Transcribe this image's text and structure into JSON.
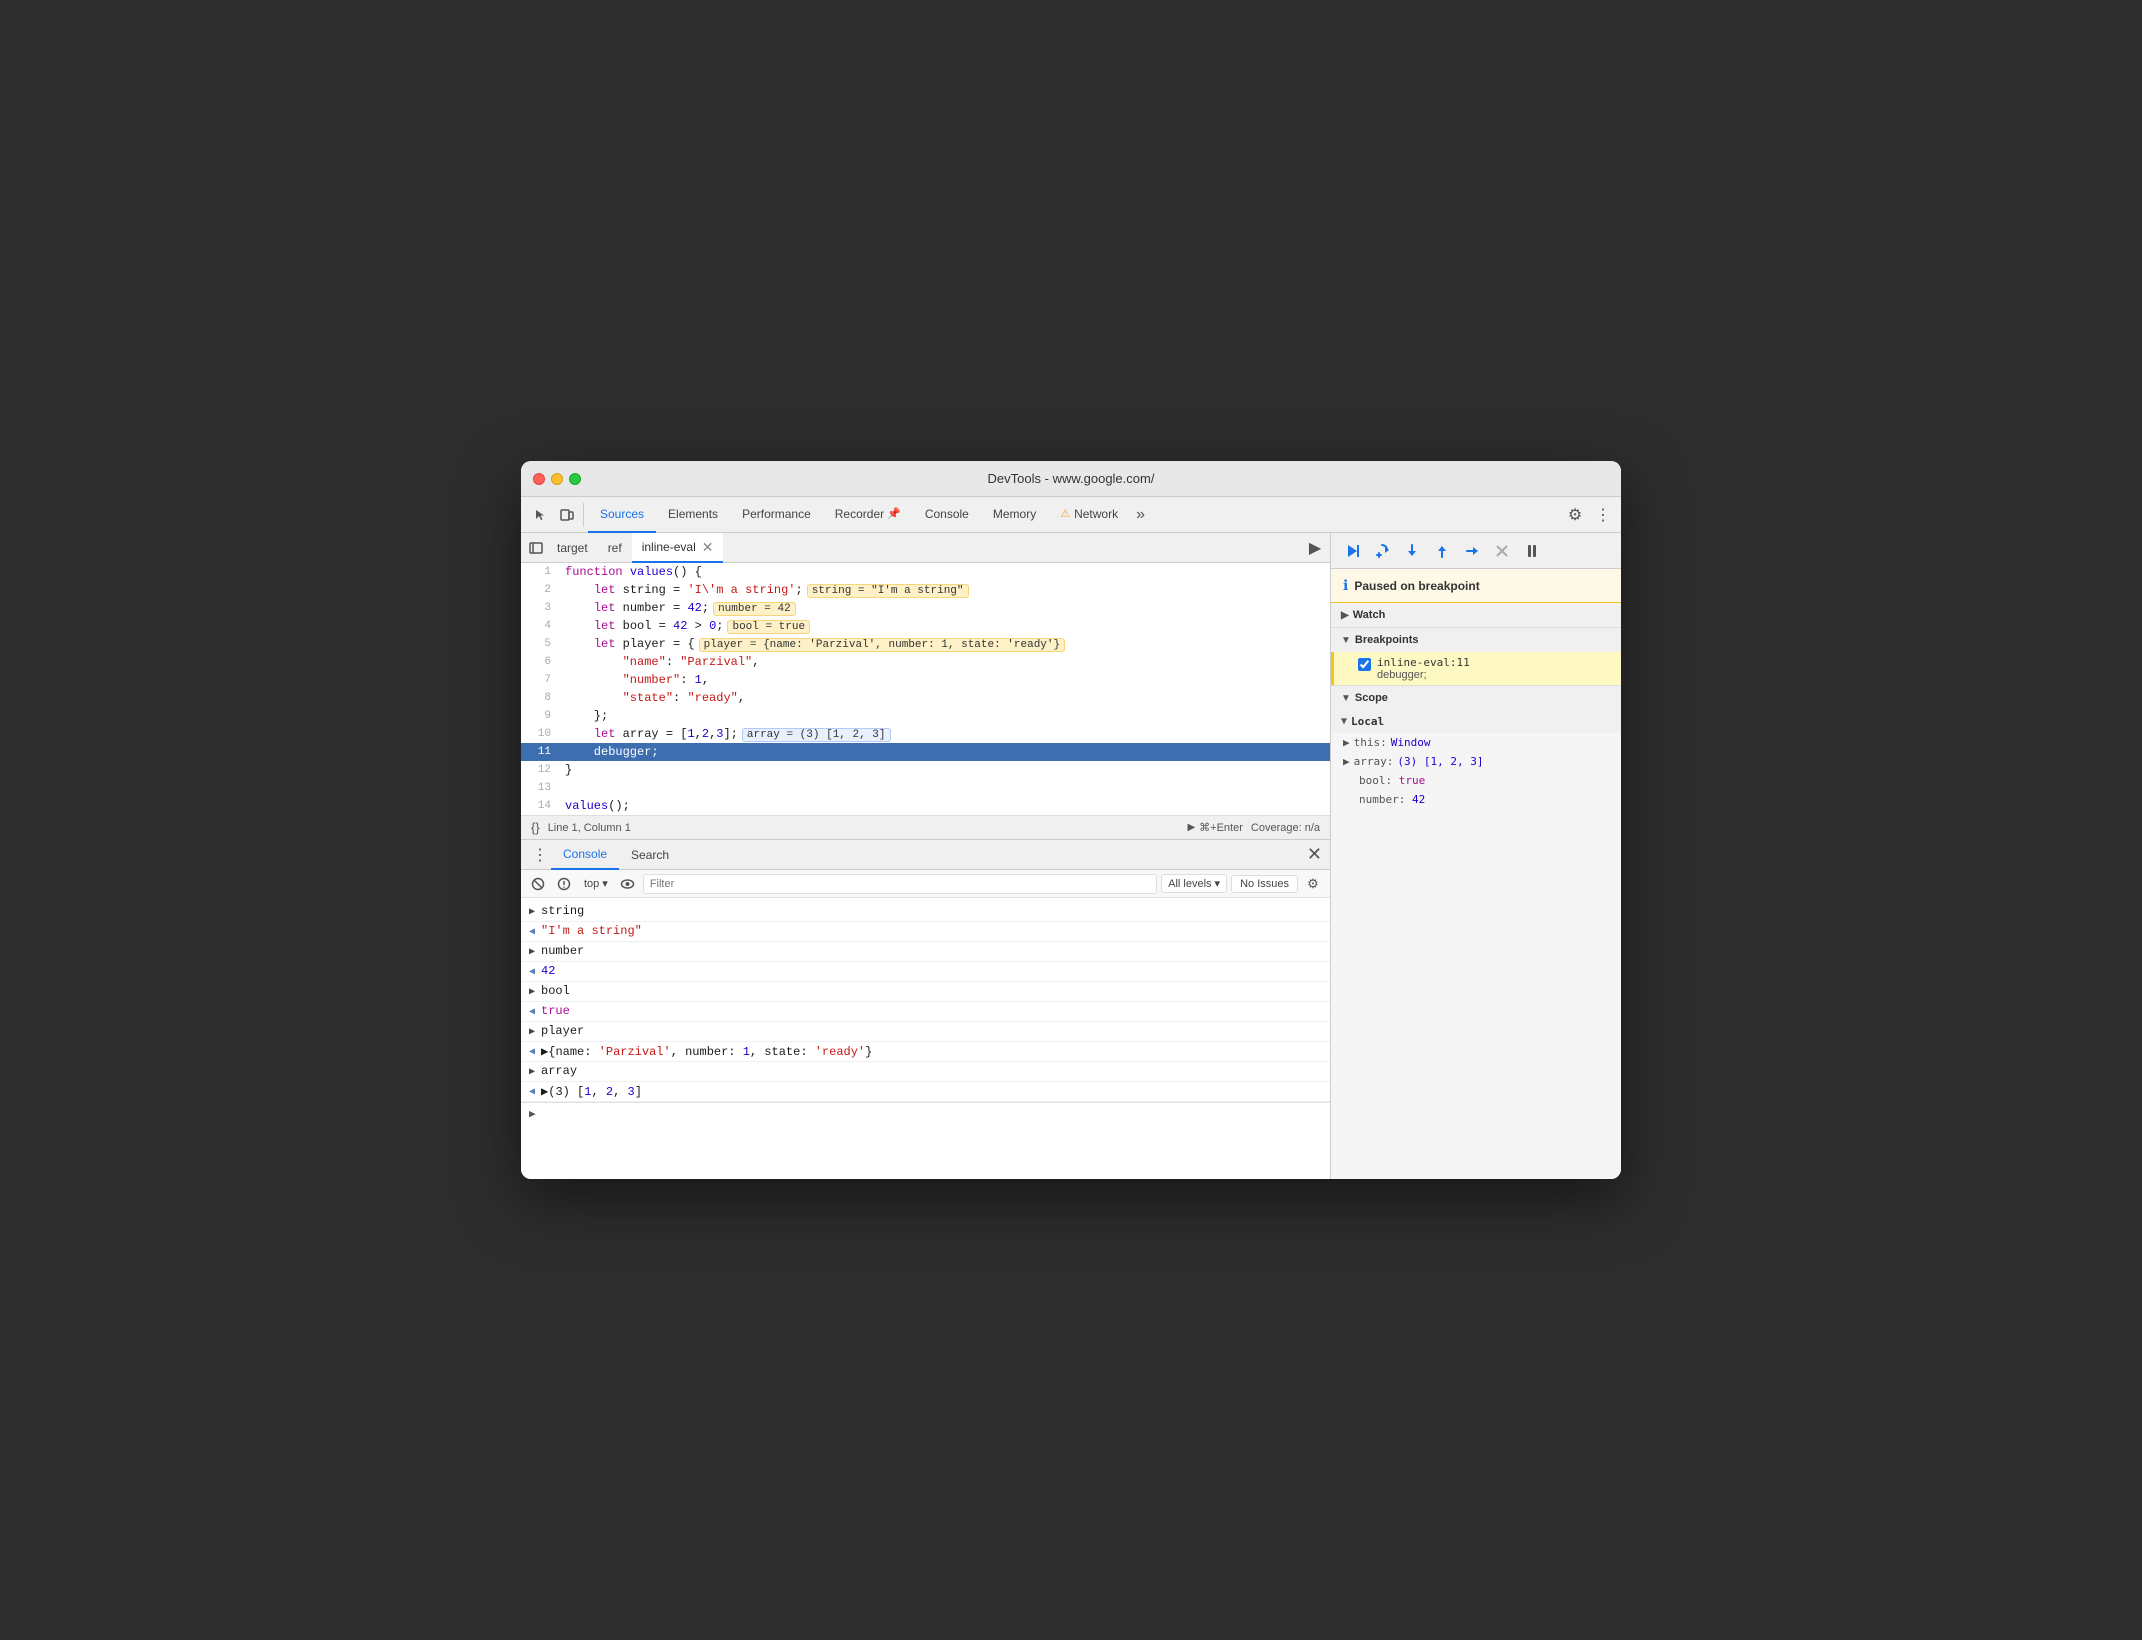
{
  "window": {
    "title": "DevTools - www.google.com/"
  },
  "devtools": {
    "tabs": [
      {
        "label": "Sources",
        "active": true
      },
      {
        "label": "Elements",
        "active": false
      },
      {
        "label": "Performance",
        "active": false
      },
      {
        "label": "Recorder",
        "active": false,
        "icon": "pin"
      },
      {
        "label": "Console",
        "active": false
      },
      {
        "label": "Memory",
        "active": false
      },
      {
        "label": "Network",
        "active": false,
        "icon": "warning"
      }
    ],
    "more_label": "»",
    "gear_icon": "⚙",
    "more_vert_icon": "⋮"
  },
  "source_panel": {
    "tabs": [
      {
        "label": "target",
        "active": false
      },
      {
        "label": "ref",
        "active": false
      },
      {
        "label": "inline-eval",
        "active": true,
        "closeable": true
      }
    ],
    "jump_icon": "▶",
    "code_lines": [
      {
        "num": 1,
        "content": "function values() {"
      },
      {
        "num": 2,
        "content": "    let string = 'I\\'m a string';",
        "inline": "string = \"I'm a string\""
      },
      {
        "num": 3,
        "content": "    let number = 42;",
        "inline": "number = 42"
      },
      {
        "num": 4,
        "content": "    let bool = 42 > 0;",
        "inline": "bool = true"
      },
      {
        "num": 5,
        "content": "    let player = {",
        "inline": "player = {name: 'Parzival', number: 1, state: 'ready'}"
      },
      {
        "num": 6,
        "content": "        \"name\": \"Parzival\","
      },
      {
        "num": 7,
        "content": "        \"number\": 1,"
      },
      {
        "num": 8,
        "content": "        \"state\": \"ready\","
      },
      {
        "num": 9,
        "content": "    };"
      },
      {
        "num": 10,
        "content": "    let array = [1,2,3];",
        "array": "array = (3) [1, 2, 3]"
      },
      {
        "num": 11,
        "content": "    debugger;",
        "active": true
      },
      {
        "num": 12,
        "content": "}"
      },
      {
        "num": 13,
        "content": ""
      },
      {
        "num": 14,
        "content": "values();"
      }
    ]
  },
  "status_bar": {
    "icon": "{}",
    "position": "Line 1, Column 1",
    "run_label": "⌘+Enter",
    "coverage": "Coverage: n/a"
  },
  "console_panel": {
    "tabs": [
      {
        "label": "Console",
        "active": true
      },
      {
        "label": "Search",
        "active": false
      }
    ],
    "close_icon": "✕",
    "toolbar": {
      "clear_icon": "🚫",
      "top_label": "top",
      "top_arrow": "▾",
      "eye_icon": "👁",
      "filter_placeholder": "Filter",
      "all_levels_label": "All levels",
      "all_levels_arrow": "▾",
      "no_issues_label": "No Issues",
      "gear_icon": "⚙"
    },
    "output": [
      {
        "type": "expand",
        "value": "string"
      },
      {
        "type": "return",
        "value": "\"I'm a string\"",
        "color": "string"
      },
      {
        "type": "expand",
        "value": "number"
      },
      {
        "type": "return",
        "value": "42",
        "color": "number"
      },
      {
        "type": "expand",
        "value": "bool"
      },
      {
        "type": "return",
        "value": "true",
        "color": "bool"
      },
      {
        "type": "expand",
        "value": "player"
      },
      {
        "type": "return",
        "value": "▶{name: 'Parzival', number: 1, state: 'ready'}",
        "color": "obj"
      },
      {
        "type": "expand",
        "value": "array"
      },
      {
        "type": "return",
        "value": "▶(3) [1, 2, 3]",
        "color": "obj"
      }
    ],
    "prompt": ">"
  },
  "right_panel": {
    "debugger_buttons": [
      {
        "icon": "▶",
        "label": "resume",
        "active": true
      },
      {
        "icon": "↺",
        "label": "step-over",
        "active": true
      },
      {
        "icon": "↓",
        "label": "step-into",
        "active": true
      },
      {
        "icon": "↑",
        "label": "step-out",
        "active": true
      },
      {
        "icon": "⇢",
        "label": "step",
        "active": true
      },
      {
        "icon": "✕",
        "label": "deactivate-breakpoints",
        "active": false
      },
      {
        "icon": "⏸",
        "label": "pause-on-exceptions",
        "active": false
      }
    ],
    "paused_message": "Paused on breakpoint",
    "watch": {
      "label": "Watch",
      "collapsed": true,
      "arrow": "▶"
    },
    "breakpoints": {
      "label": "Breakpoints",
      "arrow": "▼",
      "items": [
        {
          "file": "inline-eval:11",
          "code": "debugger;",
          "checked": true
        }
      ]
    },
    "scope": {
      "label": "Scope",
      "arrow": "▼"
    },
    "local": {
      "label": "Local",
      "arrow": "▼",
      "items": [
        {
          "key": "this:",
          "val": "Window",
          "expandable": true
        },
        {
          "key": "array:",
          "val": "(3) [1, 2, 3]",
          "expandable": true
        },
        {
          "key": "bool:",
          "val": "true",
          "color": "bool"
        },
        {
          "key": "number:",
          "val": "42",
          "color": "num"
        }
      ]
    }
  }
}
